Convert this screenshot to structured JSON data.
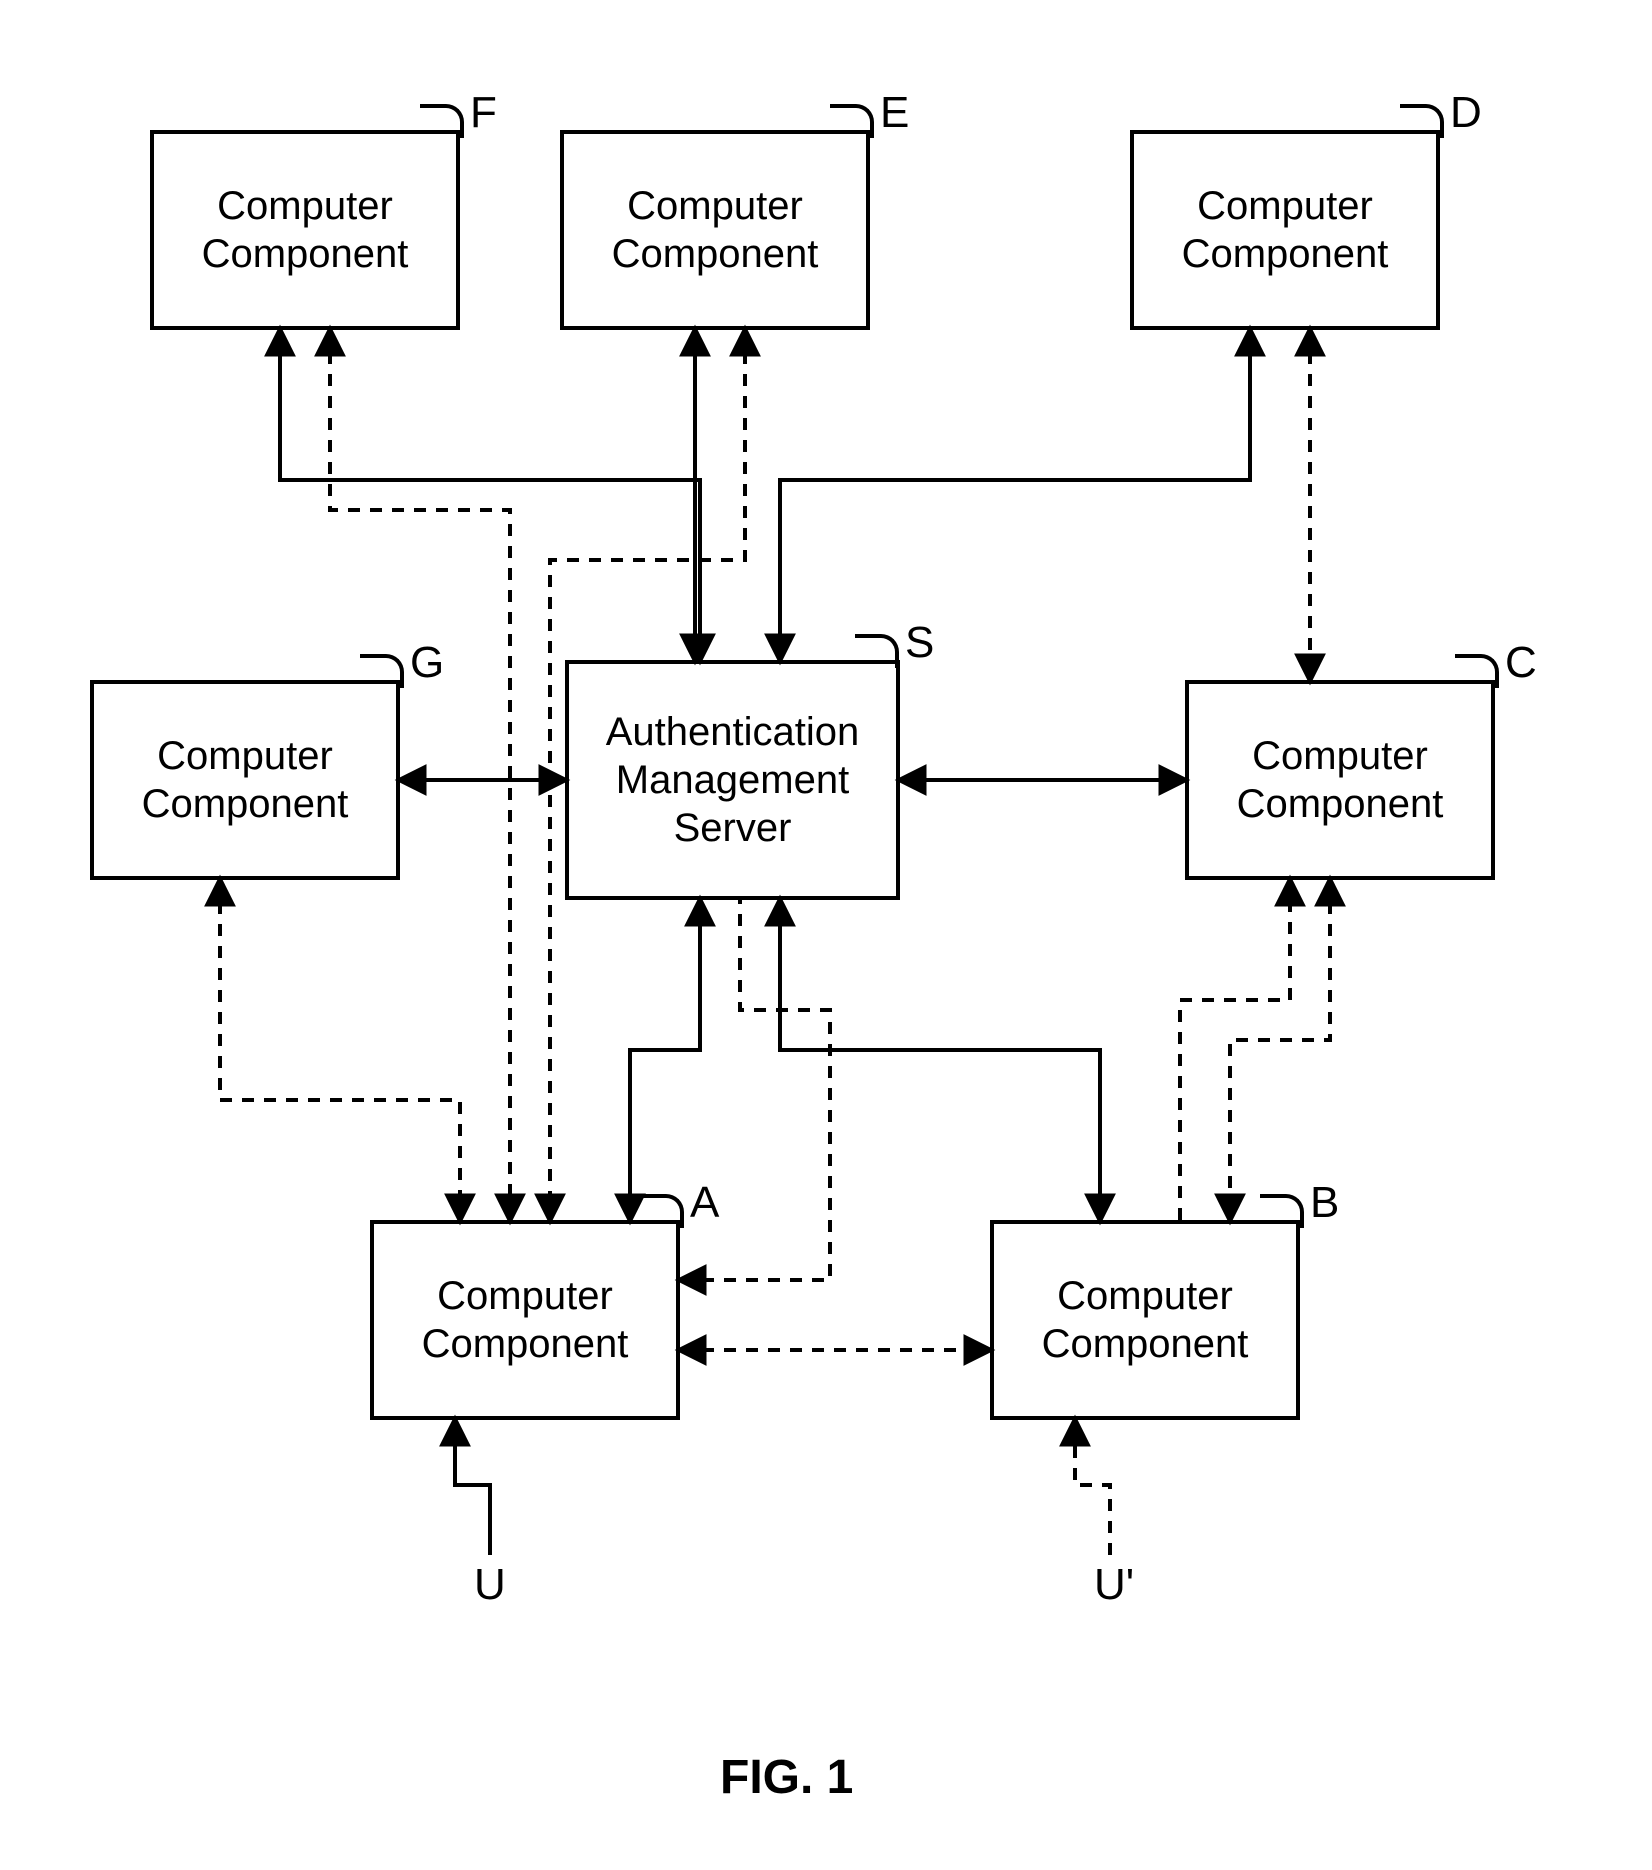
{
  "nodes": {
    "F": {
      "text": "Computer\nComponent",
      "letter": "F"
    },
    "E": {
      "text": "Computer\nComponent",
      "letter": "E"
    },
    "D": {
      "text": "Computer\nComponent",
      "letter": "D"
    },
    "G": {
      "text": "Computer\nComponent",
      "letter": "G"
    },
    "S": {
      "text": "Authentication\nManagement\nServer",
      "letter": "S"
    },
    "C": {
      "text": "Computer\nComponent",
      "letter": "C"
    },
    "A": {
      "text": "Computer\nComponent",
      "letter": "A"
    },
    "B": {
      "text": "Computer\nComponent",
      "letter": "B"
    },
    "U": {
      "text": "U"
    },
    "Uprime": {
      "text": "U'"
    }
  },
  "caption": "FIG. 1"
}
